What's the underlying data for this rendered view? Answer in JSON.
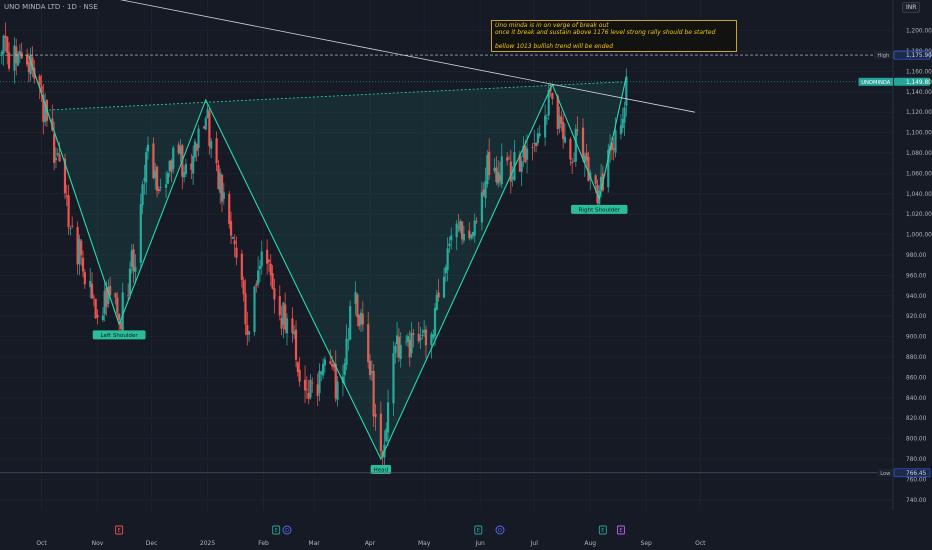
{
  "header": {
    "symbol": "UNO MINDA LTD · 1D · NSE",
    "currency": "INR"
  },
  "note": {
    "line1": "Uno minda is in on verge of break out",
    "line2": "once it break and sustain above 1176 level strong rally should be started",
    "line3": "bellow 1013 bullish trend will be ended"
  },
  "colors": {
    "up": "#26a69a",
    "down": "#ef5350",
    "pattern": "#26d9b0",
    "trendline": "#d1d4dc",
    "background": "#161a25"
  },
  "chart_data": {
    "type": "candlestick",
    "symbol": "UNOMINDA",
    "ylim": [
      730,
      1230
    ],
    "y_ticks": [
      740,
      760,
      780,
      800,
      820,
      840,
      860,
      880,
      900,
      920,
      940,
      960,
      980,
      1000,
      1020,
      1040,
      1060,
      1080,
      1100,
      1120,
      1140,
      1160,
      1180,
      1200
    ],
    "x_labels": [
      "Oct",
      "Nov",
      "Dec",
      "2025",
      "Feb",
      "Mar",
      "Apr",
      "May",
      "Jun",
      "Jul",
      "Aug",
      "Sep",
      "Oct"
    ],
    "price_tags": [
      {
        "label": "",
        "value": "1,176.05",
        "price": 1176.05,
        "style": "outline"
      },
      {
        "label": "High",
        "value": "1,175.90",
        "price": 1175.9,
        "style": "blue"
      },
      {
        "label": "UNOMINDA",
        "value": "1,149.80",
        "price": 1149.8,
        "style": "green"
      },
      {
        "label": "Low",
        "value": "766.45",
        "price": 766.45,
        "style": "blue"
      }
    ],
    "pattern": {
      "name": "inverse head and shoulders",
      "labels": [
        "Left Shoulder",
        "Head",
        "Right Shoulder"
      ],
      "points": [
        {
          "date": "2024-09-24",
          "price": 1175
        },
        {
          "date": "2024-11-13",
          "price": 912
        },
        {
          "date": "2024-12-31",
          "price": 1132
        },
        {
          "date": "2025-04-07",
          "price": 780
        },
        {
          "date": "2025-07-11",
          "price": 1147
        },
        {
          "date": "2025-08-06",
          "price": 1035
        },
        {
          "date": "2025-08-21",
          "price": 1155
        }
      ],
      "neckline": [
        {
          "date": "2024-10-03",
          "price": 1122
        },
        {
          "date": "2025-08-22",
          "price": 1150
        }
      ]
    },
    "trendline": [
      {
        "date": "2024-08-20",
        "price": 1260
      },
      {
        "date": "2025-09-28",
        "price": 1120
      }
    ],
    "levels": [
      1176.05,
      766.45
    ],
    "path": [
      {
        "date": "2024-09-24",
        "price": 1175
      },
      {
        "date": "2024-10-03",
        "price": 1115
      },
      {
        "date": "2024-10-12",
        "price": 1050
      },
      {
        "date": "2024-10-22",
        "price": 980
      },
      {
        "date": "2024-10-31",
        "price": 925
      },
      {
        "date": "2024-11-08",
        "price": 945
      },
      {
        "date": "2024-11-13",
        "price": 912
      },
      {
        "date": "2024-11-22",
        "price": 985
      },
      {
        "date": "2024-11-29",
        "price": 1085
      },
      {
        "date": "2024-12-07",
        "price": 1040
      },
      {
        "date": "2024-12-14",
        "price": 1085
      },
      {
        "date": "2024-12-22",
        "price": 1055
      },
      {
        "date": "2024-12-31",
        "price": 1115
      },
      {
        "date": "2025-01-08",
        "price": 1050
      },
      {
        "date": "2025-01-16",
        "price": 980
      },
      {
        "date": "2025-01-24",
        "price": 900
      },
      {
        "date": "2025-02-01",
        "price": 1010
      },
      {
        "date": "2025-02-08",
        "price": 925
      },
      {
        "date": "2025-02-15",
        "price": 910
      },
      {
        "date": "2025-02-22",
        "price": 860
      },
      {
        "date": "2025-03-01",
        "price": 835
      },
      {
        "date": "2025-03-08",
        "price": 870
      },
      {
        "date": "2025-03-15",
        "price": 845
      },
      {
        "date": "2025-03-22",
        "price": 940
      },
      {
        "date": "2025-03-29",
        "price": 905
      },
      {
        "date": "2025-04-07",
        "price": 780
      },
      {
        "date": "2025-04-14",
        "price": 880
      },
      {
        "date": "2025-04-21",
        "price": 895
      },
      {
        "date": "2025-04-28",
        "price": 895
      },
      {
        "date": "2025-05-05",
        "price": 910
      },
      {
        "date": "2025-05-12",
        "price": 970
      },
      {
        "date": "2025-05-20",
        "price": 1005
      },
      {
        "date": "2025-05-28",
        "price": 1010
      },
      {
        "date": "2025-06-05",
        "price": 1070
      },
      {
        "date": "2025-06-14",
        "price": 1060
      },
      {
        "date": "2025-06-22",
        "price": 1070
      },
      {
        "date": "2025-06-30",
        "price": 1100
      },
      {
        "date": "2025-07-06",
        "price": 1110
      },
      {
        "date": "2025-07-11",
        "price": 1145
      },
      {
        "date": "2025-07-18",
        "price": 1080
      },
      {
        "date": "2025-07-25",
        "price": 1090
      },
      {
        "date": "2025-08-01",
        "price": 1065
      },
      {
        "date": "2025-08-06",
        "price": 1040
      },
      {
        "date": "2025-08-12",
        "price": 1090
      },
      {
        "date": "2025-08-16",
        "price": 1085
      },
      {
        "date": "2025-08-21",
        "price": 1150
      }
    ]
  }
}
